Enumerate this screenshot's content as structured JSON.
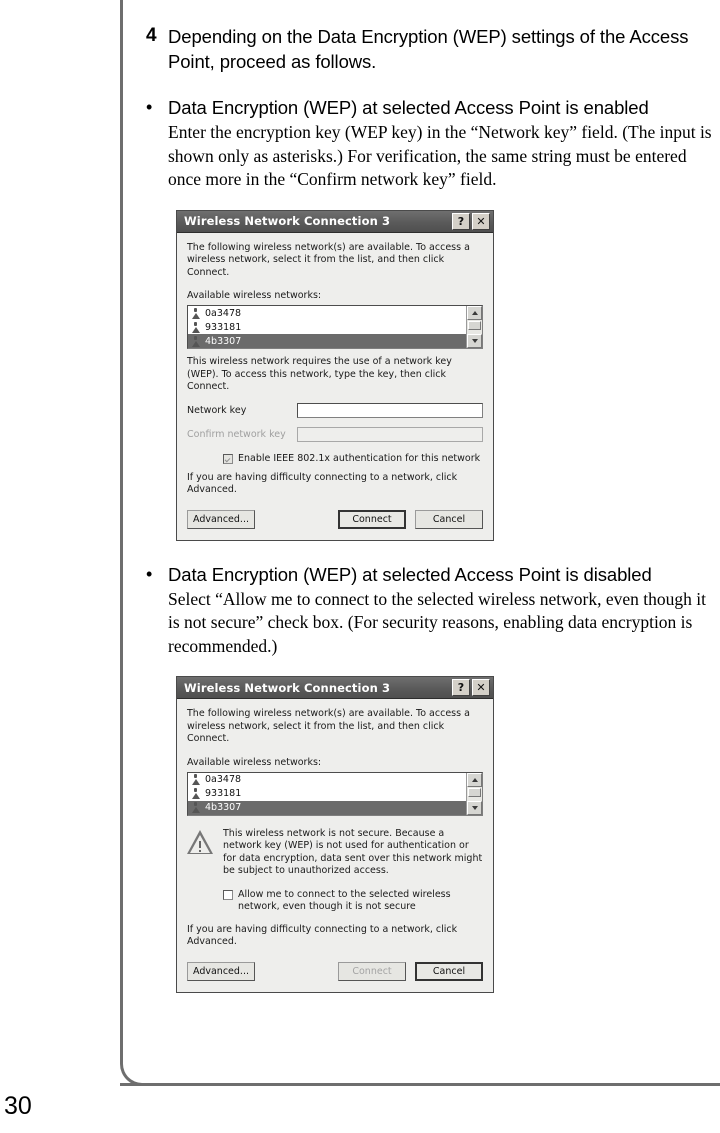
{
  "page": {
    "number": "30"
  },
  "step": {
    "number": "4",
    "text": "Depending on the Data Encryption (WEP) settings of the Access Point, proceed as follows."
  },
  "sections": [
    {
      "bullet": "•",
      "heading": "Data Encryption (WEP) at selected Access Point is enabled",
      "body": "Enter the encryption key (WEP key) in the “Network key” field. (The input is shown only as asterisks.) For verification, the same string must be entered once more in the “Confirm network key” field."
    },
    {
      "bullet": "•",
      "heading": "Data Encryption (WEP) at selected Access Point is disabled",
      "body": "Select “Allow me to connect to the selected wireless network, even though it is not secure” check box. (For security reasons, enabling data encryption is recommended.)"
    }
  ],
  "dialog_enabled": {
    "title": "Wireless Network Connection 3",
    "help_button": "?",
    "close_button": "✕",
    "intro": "The following wireless network(s) are available. To access a wireless network, select it from the list, and then click Connect.",
    "list_label": "Available wireless networks:",
    "networks": [
      {
        "name": "0a3478",
        "selected": false
      },
      {
        "name": "933181",
        "selected": false
      },
      {
        "name": "4b3307",
        "selected": true
      }
    ],
    "key_notice": "This wireless network requires the use of a network key (WEP). To access this network, type the key, then click Connect.",
    "network_key_label": "Network key",
    "network_key_value": "",
    "confirm_key_label": "Confirm network key",
    "confirm_key_value": "",
    "checkbox_8021x_label": "Enable IEEE 802.1x authentication for this network",
    "footer_note": "If you are having difficulty connecting to a network, click Advanced.",
    "advanced_button": "Advanced...",
    "connect_button": "Connect",
    "cancel_button": "Cancel"
  },
  "dialog_disabled": {
    "title": "Wireless Network Connection 3",
    "help_button": "?",
    "close_button": "✕",
    "intro": "The following wireless network(s) are available. To access a wireless network, select it from the list, and then click Connect.",
    "list_label": "Available wireless networks:",
    "networks": [
      {
        "name": "0a3478",
        "selected": false
      },
      {
        "name": "933181",
        "selected": false
      },
      {
        "name": "4b3307",
        "selected": true
      }
    ],
    "warning_text": "This wireless network is not secure. Because a network key (WEP) is not used for authentication or for data encryption, data sent over this network might be subject to unauthorized access.",
    "checkbox_allow_label": "Allow me to connect to the selected wireless network, even though it is not secure",
    "footer_note": "If you are having difficulty connecting to a network, click Advanced.",
    "advanced_button": "Advanced...",
    "connect_button": "Connect",
    "cancel_button": "Cancel"
  },
  "colors": {
    "titlebar": "#5a5a5a",
    "selection": "#6b6b6b",
    "dialog_face": "#eeeeec",
    "page_border": "#6e6e6e"
  }
}
